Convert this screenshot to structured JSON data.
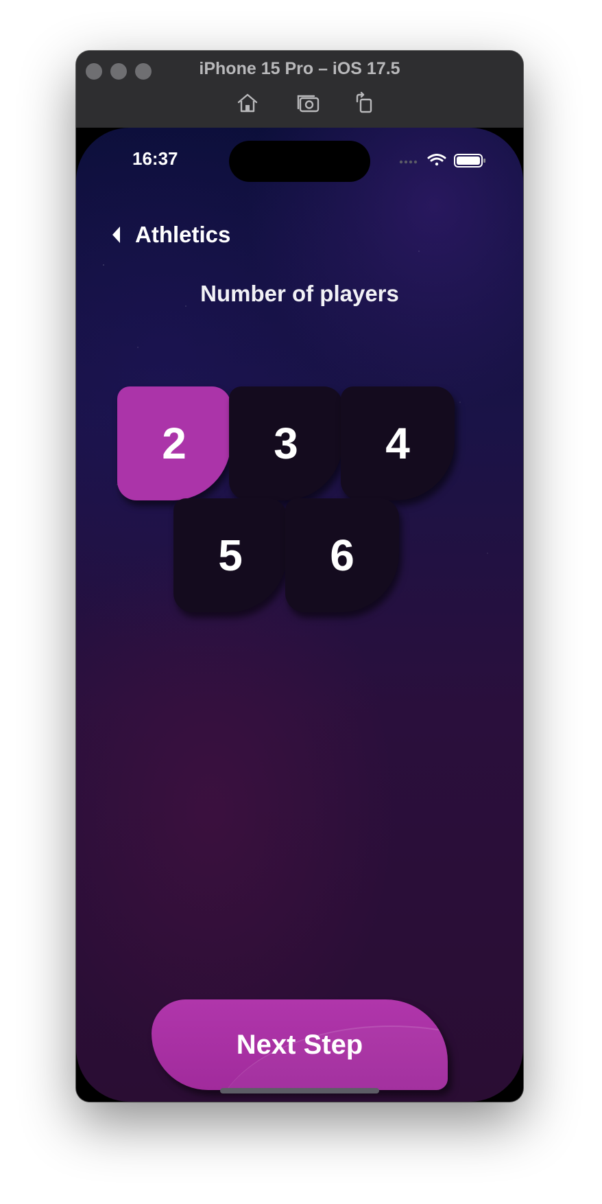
{
  "window": {
    "title": "iPhone 15 Pro – iOS 17.5"
  },
  "toolbar": {
    "icons": [
      "home-icon",
      "screenshot-icon",
      "rotate-icon"
    ]
  },
  "status_bar": {
    "time": "16:37",
    "icons": [
      "cellular-icon",
      "wifi-icon",
      "battery-icon"
    ]
  },
  "nav": {
    "back_label": "Athletics"
  },
  "main": {
    "heading": "Number of players",
    "options": [
      "2",
      "3",
      "4",
      "5",
      "6"
    ],
    "selected": "2"
  },
  "footer": {
    "next_label": "Next Step"
  },
  "colors": {
    "accent": "#ab34a9",
    "tile": "#140b1e",
    "background_top": "#0c0f3a",
    "background_bottom": "#2a0d33"
  }
}
